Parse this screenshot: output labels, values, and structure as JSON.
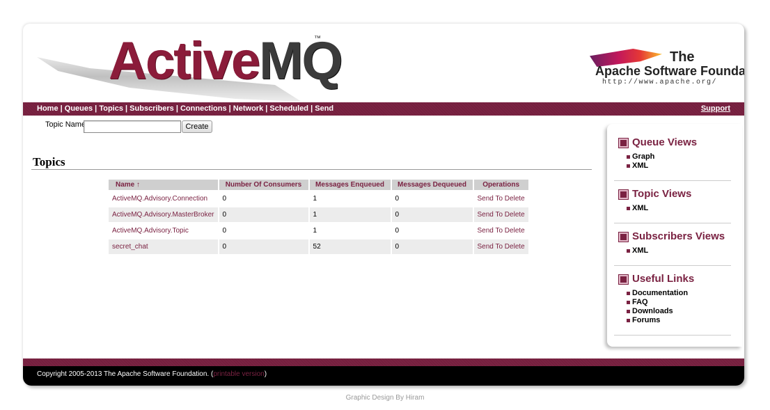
{
  "header": {
    "logo_left_part": "Active",
    "logo_right_part": "MQ",
    "logo_tm": "™",
    "apache_the": "The",
    "apache_name": "Apache Software Foundation",
    "apache_url": "http://www.apache.org/"
  },
  "nav": {
    "items": [
      {
        "label": "Home"
      },
      {
        "label": "Queues"
      },
      {
        "label": "Topics"
      },
      {
        "label": "Subscribers"
      },
      {
        "label": "Connections"
      },
      {
        "label": "Network"
      },
      {
        "label": "Scheduled"
      },
      {
        "label": "Send"
      }
    ],
    "separator": " | ",
    "support_label": "Support"
  },
  "form": {
    "label": "Topic Name",
    "input_value": "",
    "button_label": "Create"
  },
  "page_title": "Topics",
  "table": {
    "headers": [
      "Name ↑",
      "Number Of Consumers",
      "Messages Enqueued",
      "Messages Dequeued",
      "Operations"
    ],
    "rows": [
      {
        "name": "ActiveMQ.Advisory.Connection",
        "consumers": "0",
        "enqueued": "1",
        "dequeued": "0",
        "operation": "Send To Delete"
      },
      {
        "name": "ActiveMQ.Advisory.MasterBroker",
        "consumers": "0",
        "enqueued": "1",
        "dequeued": "0",
        "operation": "Send To Delete"
      },
      {
        "name": "ActiveMQ.Advisory.Topic",
        "consumers": "0",
        "enqueued": "1",
        "dequeued": "0",
        "operation": "Send To Delete"
      },
      {
        "name": "secret_chat",
        "consumers": "0",
        "enqueued": "52",
        "dequeued": "0",
        "operation": "Send To Delete"
      }
    ]
  },
  "sidebar": {
    "sections": [
      {
        "title": "Queue Views",
        "items": [
          "Graph",
          "XML"
        ]
      },
      {
        "title": "Topic Views",
        "items": [
          "XML"
        ]
      },
      {
        "title": "Subscribers Views",
        "items": [
          "XML"
        ]
      },
      {
        "title": "Useful Links",
        "items": [
          "Documentation",
          "FAQ",
          "Downloads",
          "Forums"
        ]
      }
    ]
  },
  "footer": {
    "copyright": "Copyright 2005-2013 The Apache Software Foundation. (",
    "printable_link": "printable version",
    "close_paren": ")"
  },
  "design_credit": "Graphic Design By Hiram",
  "colors": {
    "brand": "#7a2242",
    "nav_bg": "#7a2242",
    "footer_bg": "#000000",
    "header_cell_bg": "#cfcfcf",
    "row_alt_bg": "#ececec"
  }
}
